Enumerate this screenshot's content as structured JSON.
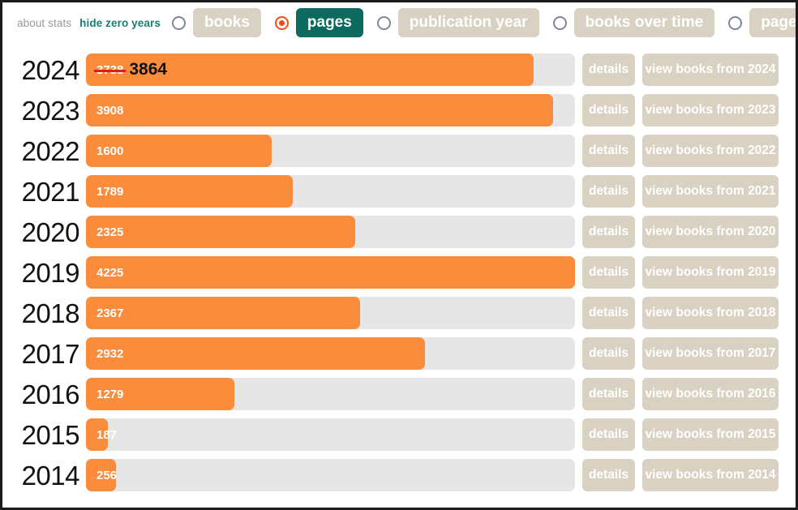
{
  "toolbar": {
    "about_label": "about stats",
    "hide_zero_label": "hide zero years",
    "options": [
      {
        "label": "books",
        "selected": false
      },
      {
        "label": "pages",
        "selected": true
      },
      {
        "label": "publication year",
        "selected": false
      },
      {
        "label": "books over time",
        "selected": false
      },
      {
        "label": "pages over time",
        "selected": false
      }
    ]
  },
  "buttons": {
    "details_label": "details",
    "view_prefix": "view books from"
  },
  "colors": {
    "bar": "#fb8c3c",
    "track": "#e6e6e6",
    "pill": "#d9d2c3",
    "pill_active": "#0d6a5f",
    "teal_link": "#177e76",
    "muted_link": "#9a9a9a",
    "radio_on": "#f04d17",
    "strike": "#e8191b"
  },
  "chart_data": {
    "type": "bar",
    "title": "",
    "xlabel": "",
    "ylabel": "pages",
    "orientation": "horizontal",
    "metric": "pages",
    "categories": [
      "2024",
      "2023",
      "2022",
      "2021",
      "2020",
      "2019",
      "2018",
      "2017",
      "2016",
      "2015",
      "2014"
    ],
    "values": [
      3864,
      3908,
      1600,
      1789,
      2325,
      4225,
      2367,
      2932,
      1279,
      187,
      256
    ],
    "xlim": [
      0,
      4225
    ],
    "grid": false,
    "legend": null,
    "annotations": [
      {
        "category": "2024",
        "struck_value": "3738",
        "corrected_value": "3864"
      }
    ],
    "rows": [
      {
        "year": "2024",
        "value": 3864,
        "label": "3864",
        "struck": "3738",
        "corrected": "3864",
        "width_pct": 91.5,
        "view_label": "view books from 2024"
      },
      {
        "year": "2023",
        "value": 3908,
        "label": "3908",
        "struck": null,
        "corrected": null,
        "width_pct": 95.5,
        "view_label": "view books from 2023"
      },
      {
        "year": "2022",
        "value": 1600,
        "label": "1600",
        "struck": null,
        "corrected": null,
        "width_pct": 37.9,
        "view_label": "view books from 2022"
      },
      {
        "year": "2021",
        "value": 1789,
        "label": "1789",
        "struck": null,
        "corrected": null,
        "width_pct": 42.3,
        "view_label": "view books from 2021"
      },
      {
        "year": "2020",
        "value": 2325,
        "label": "2325",
        "struck": null,
        "corrected": null,
        "width_pct": 55.1,
        "view_label": "view books from 2020"
      },
      {
        "year": "2019",
        "value": 4225,
        "label": "4225",
        "struck": null,
        "corrected": null,
        "width_pct": 100.0,
        "view_label": "view books from 2019"
      },
      {
        "year": "2018",
        "value": 2367,
        "label": "2367",
        "struck": null,
        "corrected": null,
        "width_pct": 56.1,
        "view_label": "view books from 2018"
      },
      {
        "year": "2017",
        "value": 2932,
        "label": "2932",
        "struck": null,
        "corrected": null,
        "width_pct": 69.4,
        "view_label": "view books from 2017"
      },
      {
        "year": "2016",
        "value": 1279,
        "label": "1279",
        "struck": null,
        "corrected": null,
        "width_pct": 30.3,
        "view_label": "view books from 2016"
      },
      {
        "year": "2015",
        "value": 187,
        "label": "187",
        "struck": null,
        "corrected": null,
        "width_pct": 4.4,
        "view_label": "view books from 2015"
      },
      {
        "year": "2014",
        "value": 256,
        "label": "256",
        "struck": null,
        "corrected": null,
        "width_pct": 6.1,
        "view_label": "view books from 2014"
      }
    ]
  }
}
